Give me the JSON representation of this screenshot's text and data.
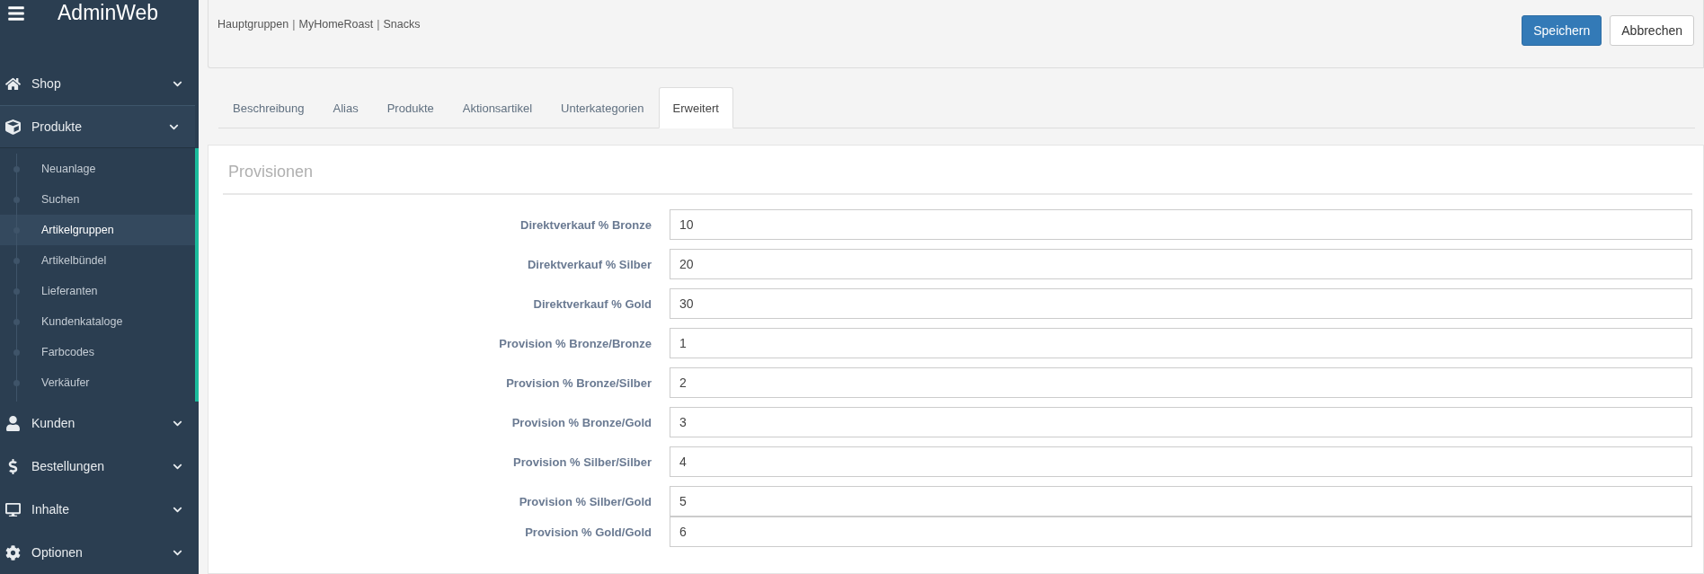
{
  "sidebar": {
    "title": "AdminWeb",
    "items": [
      {
        "label": "Shop",
        "expanded": false
      },
      {
        "label": "Produkte",
        "expanded": true,
        "children": [
          {
            "label": "Neuanlage",
            "selected": false
          },
          {
            "label": "Suchen",
            "selected": false
          },
          {
            "label": "Artikelgruppen",
            "selected": true
          },
          {
            "label": "Artikelbündel",
            "selected": false
          },
          {
            "label": "Lieferanten",
            "selected": false
          },
          {
            "label": "Kundenkataloge",
            "selected": false
          },
          {
            "label": "Farbcodes",
            "selected": false
          },
          {
            "label": "Verkäufer",
            "selected": false
          }
        ]
      },
      {
        "label": "Kunden",
        "expanded": false
      },
      {
        "label": "Bestellungen",
        "expanded": false
      },
      {
        "label": "Inhalte",
        "expanded": false
      },
      {
        "label": "Optionen",
        "expanded": false
      }
    ]
  },
  "breadcrumb": [
    {
      "label": "Hauptgruppen",
      "kind": "link"
    },
    {
      "label": "|",
      "kind": "separator"
    },
    {
      "label": "MyHomeRoast",
      "kind": "link"
    },
    {
      "label": "|",
      "kind": "separator"
    },
    {
      "label": "Snacks",
      "kind": "link"
    }
  ],
  "buttons": [
    {
      "label": "Speichern",
      "kind": "primary"
    },
    {
      "label": "Abbrechen",
      "kind": "default"
    }
  ],
  "tabs": [
    {
      "label": "Beschreibung",
      "selected": false
    },
    {
      "label": "Alias",
      "selected": false
    },
    {
      "label": "Produkte",
      "selected": false
    },
    {
      "label": "Aktionsartikel",
      "selected": false
    },
    {
      "label": "Unterkategorien",
      "selected": false
    },
    {
      "label": "Erweitert",
      "selected": true
    }
  ],
  "section": {
    "title": "Provisionen",
    "fields": [
      {
        "label": "Direktverkauf % Bronze",
        "value": "10"
      },
      {
        "label": "Direktverkauf % Silber",
        "value": "20"
      },
      {
        "label": "Direktverkauf % Gold",
        "value": "30"
      },
      {
        "label": "Provision % Bronze/Bronze",
        "value": "1"
      },
      {
        "label": "Provision % Bronze/Silber",
        "value": "2"
      },
      {
        "label": "Provision % Bronze/Gold",
        "value": "3"
      },
      {
        "label": "Provision % Silber/Silber",
        "value": "4"
      },
      {
        "label": "Provision % Silber/Gold",
        "value": "5"
      },
      {
        "label": "Provision % Gold/Gold",
        "value": "6"
      }
    ]
  }
}
